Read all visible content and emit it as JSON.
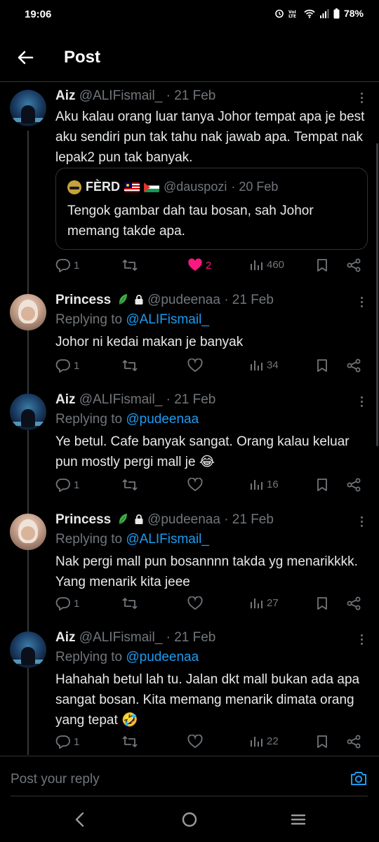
{
  "status_bar": {
    "time": "19:06",
    "battery": "78%"
  },
  "header": {
    "title": "Post"
  },
  "tweets": [
    {
      "name": "Aiz",
      "handle": "@ALIFismail_",
      "date": "· 21 Feb",
      "text": "Aku kalau orang luar tanya Johor tempat apa je best aku sendiri pun tak tahu nak jawab apa. Tempat nak lepak2 pun tak banyak.",
      "quote": {
        "name": "FÈRD",
        "handle": "@dauspozi",
        "date": "· 20 Feb",
        "text": "Tengok gambar dah tau bosan, sah Johor memang takde apa."
      },
      "replies": "1",
      "likes": "2",
      "views": "460"
    },
    {
      "name": "Princess",
      "handle": "@pudeenaa",
      "date": "· 21 Feb",
      "replying_label": "Replying to",
      "replying_to": "@ALIFismail_",
      "text": "Johor ni kedai makan je banyak",
      "replies": "1",
      "views": "34"
    },
    {
      "name": "Aiz",
      "handle": "@ALIFismail_",
      "date": "· 21 Feb",
      "replying_label": "Replying to",
      "replying_to": "@pudeenaa",
      "text": "Ye betul. Cafe banyak sangat. Orang kalau keluar pun mostly pergi mall je 😂",
      "replies": "1",
      "views": "16"
    },
    {
      "name": "Princess",
      "handle": "@pudeenaa",
      "date": "· 21 Feb",
      "replying_label": "Replying to",
      "replying_to": "@ALIFismail_",
      "text": "Nak pergi mall pun bosannnn takda yg menarikkkk. Yang menarik kita jeee",
      "replies": "1",
      "views": "27"
    },
    {
      "name": "Aiz",
      "handle": "@ALIFismail_",
      "date": "· 21 Feb",
      "replying_label": "Replying to",
      "replying_to": "@pudeenaa",
      "text": "Hahahah betul lah tu. Jalan dkt mall bukan ada apa sangat bosan. Kita memang menarik dimata orang yang tepat 🤣",
      "replies": "1",
      "views": "22"
    }
  ],
  "reply_box": {
    "placeholder": "Post your reply"
  },
  "colors": {
    "accent": "#1d9bf0",
    "like": "#f91880",
    "muted": "#71767b",
    "text": "#e7e9ea"
  },
  "icons": [
    "back-arrow-icon",
    "more-icon",
    "reply-icon",
    "retweet-icon",
    "heart-icon",
    "views-icon",
    "bookmark-icon",
    "share-icon",
    "camera-icon",
    "leaf-icon",
    "lock-icon"
  ]
}
